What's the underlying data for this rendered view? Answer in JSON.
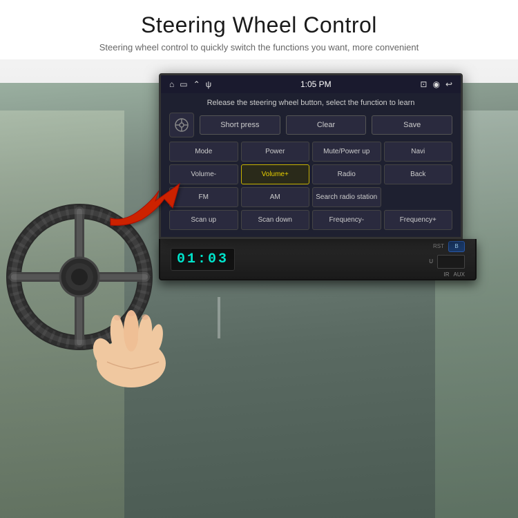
{
  "header": {
    "title": "Steering Wheel Control",
    "subtitle": "Steering wheel control to quickly switch the functions you want, more convenient"
  },
  "status_bar": {
    "time": "1:05 PM",
    "icons_left": [
      "home",
      "screen",
      "up-arrow",
      "usb"
    ],
    "icons_right": [
      "cast",
      "location",
      "back"
    ]
  },
  "screen": {
    "instruction": "Release the steering wheel button, select the function to learn",
    "steering_wheel_icon": "⊙",
    "top_buttons": [
      "Short press",
      "Clear",
      "Save"
    ],
    "grid_buttons": [
      {
        "label": "Mode",
        "highlighted": false
      },
      {
        "label": "Power",
        "highlighted": false
      },
      {
        "label": "Mute/Power up",
        "highlighted": false
      },
      {
        "label": "Navi",
        "highlighted": false
      },
      {
        "label": "Volume-",
        "highlighted": false
      },
      {
        "label": "Volume+",
        "highlighted": true
      },
      {
        "label": "Radio",
        "highlighted": false
      },
      {
        "label": "Back",
        "highlighted": false
      },
      {
        "label": "FM",
        "highlighted": false
      },
      {
        "label": "AM",
        "highlighted": false
      },
      {
        "label": "Search radio station",
        "highlighted": false
      },
      {
        "label": "Scan up",
        "highlighted": false
      },
      {
        "label": "Scan down",
        "highlighted": false
      },
      {
        "label": "Frequency-",
        "highlighted": false
      },
      {
        "label": "Frequency+",
        "highlighted": false
      }
    ]
  },
  "hardware": {
    "display_time": "01:03",
    "rst_label": "RST",
    "b_label": "B",
    "u_label": "U",
    "ir_label": "IR",
    "aux_label": "AUX"
  },
  "colors": {
    "accent": "#c8b400",
    "display_color": "#00e5cc",
    "screen_bg": "#1e2030",
    "hardware_bg": "#1a1a1a"
  }
}
